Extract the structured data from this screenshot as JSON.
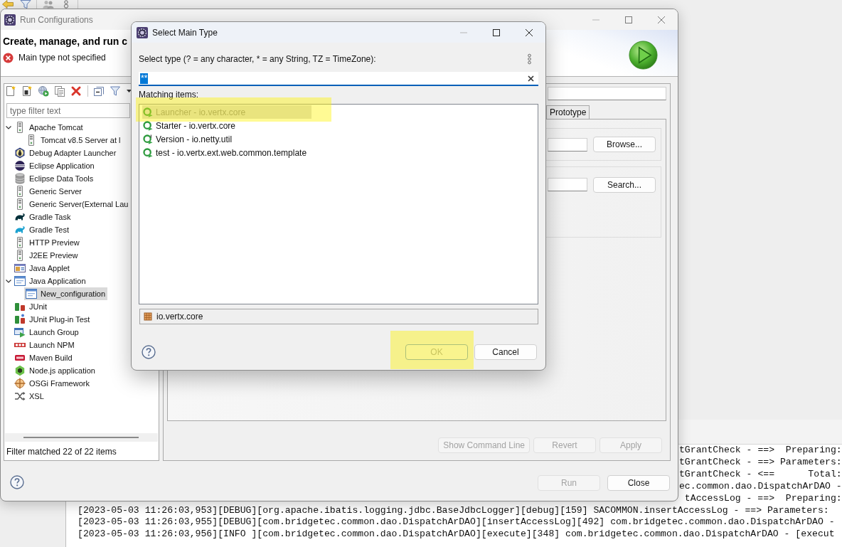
{
  "run_configurations": {
    "title": "Run Configurations",
    "focused": false,
    "heading": "Create, manage, and run c",
    "message": {
      "kind": "error",
      "text": "Main type not specified"
    },
    "filter": {
      "placeholder": "type filter text"
    },
    "tree": [
      {
        "label": "Apache Tomcat",
        "kind": "server",
        "selected": false,
        "expanded": true,
        "children": [
          {
            "label": "Tomcat v8.5 Server at l",
            "kind": "server",
            "selected": false
          }
        ]
      },
      {
        "label": "Debug Adapter Launcher",
        "kind": "bug",
        "selected": false
      },
      {
        "label": "Eclipse Application",
        "kind": "eclipse",
        "selected": false
      },
      {
        "label": "Eclipse Data Tools",
        "kind": "database",
        "selected": false
      },
      {
        "label": "Generic Server",
        "kind": "server",
        "selected": false
      },
      {
        "label": "Generic Server(External Lau",
        "kind": "server",
        "selected": false
      },
      {
        "label": "Gradle Task",
        "kind": "gradle",
        "selected": false
      },
      {
        "label": "Gradle Test",
        "kind": "gradletest",
        "selected": false
      },
      {
        "label": "HTTP Preview",
        "kind": "server",
        "selected": false
      },
      {
        "label": "J2EE Preview",
        "kind": "server",
        "selected": false
      },
      {
        "label": "Java Applet",
        "kind": "applet",
        "selected": false
      },
      {
        "label": "Java Application",
        "kind": "javaapp",
        "selected": false,
        "expanded": true,
        "children": [
          {
            "label": "New_configuration",
            "kind": "javaapp",
            "selected": true
          }
        ]
      },
      {
        "label": "JUnit",
        "kind": "junit",
        "selected": false
      },
      {
        "label": "JUnit Plug-in Test",
        "kind": "junitplugin",
        "selected": false
      },
      {
        "label": "Launch Group",
        "kind": "group",
        "selected": false
      },
      {
        "label": "Launch NPM",
        "kind": "npm",
        "selected": false
      },
      {
        "label": "Maven Build",
        "kind": "maven",
        "selected": false
      },
      {
        "label": "Node.js application",
        "kind": "node",
        "selected": false
      },
      {
        "label": "OSGi Framework",
        "kind": "osgi",
        "selected": false
      },
      {
        "label": "XSL",
        "kind": "xsl",
        "selected": false
      }
    ],
    "filter_status": "Filter matched 22 of 22 items",
    "tabs": [
      {
        "label": "Prototype",
        "selected": false
      }
    ],
    "groups": [
      {
        "button": "Browse..."
      },
      {
        "button": "Search..."
      }
    ],
    "panel_buttons": [
      {
        "label": "Show Command Line",
        "disabled": true
      },
      {
        "label": "Revert",
        "disabled": true
      },
      {
        "label": "Apply",
        "disabled": true
      }
    ],
    "footer_buttons": [
      {
        "label": "Run",
        "disabled": true
      },
      {
        "label": "Close",
        "disabled": false
      }
    ]
  },
  "select_main_type": {
    "title": "Select Main Type",
    "focused": true,
    "prompt": "Select type (? = any character, * = any String, TZ = TimeZone):",
    "search": {
      "value": "**",
      "value_selected": true
    },
    "list_label": "Matching items:",
    "items": [
      {
        "label": "Launcher - io.vertx.core",
        "kind": "class",
        "selected": true,
        "highlighted": true
      },
      {
        "label": "Starter - io.vertx.core",
        "kind": "class",
        "selected": false,
        "highlighted": false
      },
      {
        "label": "Version - io.netty.util",
        "kind": "finalclass",
        "selected": false,
        "highlighted": false
      },
      {
        "label": "test - io.vertx.ext.web.common.template",
        "kind": "class",
        "selected": false,
        "highlighted": false
      }
    ],
    "qualifier": "io.vertx.core",
    "buttons": [
      {
        "label": "OK",
        "disabled": true,
        "default": true,
        "highlighted": true
      },
      {
        "label": "Cancel",
        "disabled": false,
        "default": false,
        "highlighted": false
      }
    ]
  },
  "console": {
    "fragments": [
      "tGrantCheck - ==>  Preparing:",
      "tGrantCheck - ==> Parameters:",
      "tGrantCheck - <==      Total:",
      "ec.common.dao.DispatchArDAO -",
      "tAccessLog - ==>  Preparing:"
    ],
    "lines": [
      "[2023-05-03 11:26:03,953][DEBUG][org.apache.ibatis.logging.jdbc.BaseJdbcLogger][debug][159] SACOMMON.insertAccessLog - ==> Parameters:",
      "[2023-05-03 11:26:03,955][DEBUG][com.bridgetec.common.dao.DispatchArDAO][insertAccessLog][492] com.bridgetec.common.dao.DispatchArDAO -",
      "[2023-05-03 11:26:03,956][INFO ][com.bridgetec.common.dao.DispatchArDAO][execute][348] com.bridgetec.common.dao.DispatchArDAO - [execut"
    ]
  }
}
